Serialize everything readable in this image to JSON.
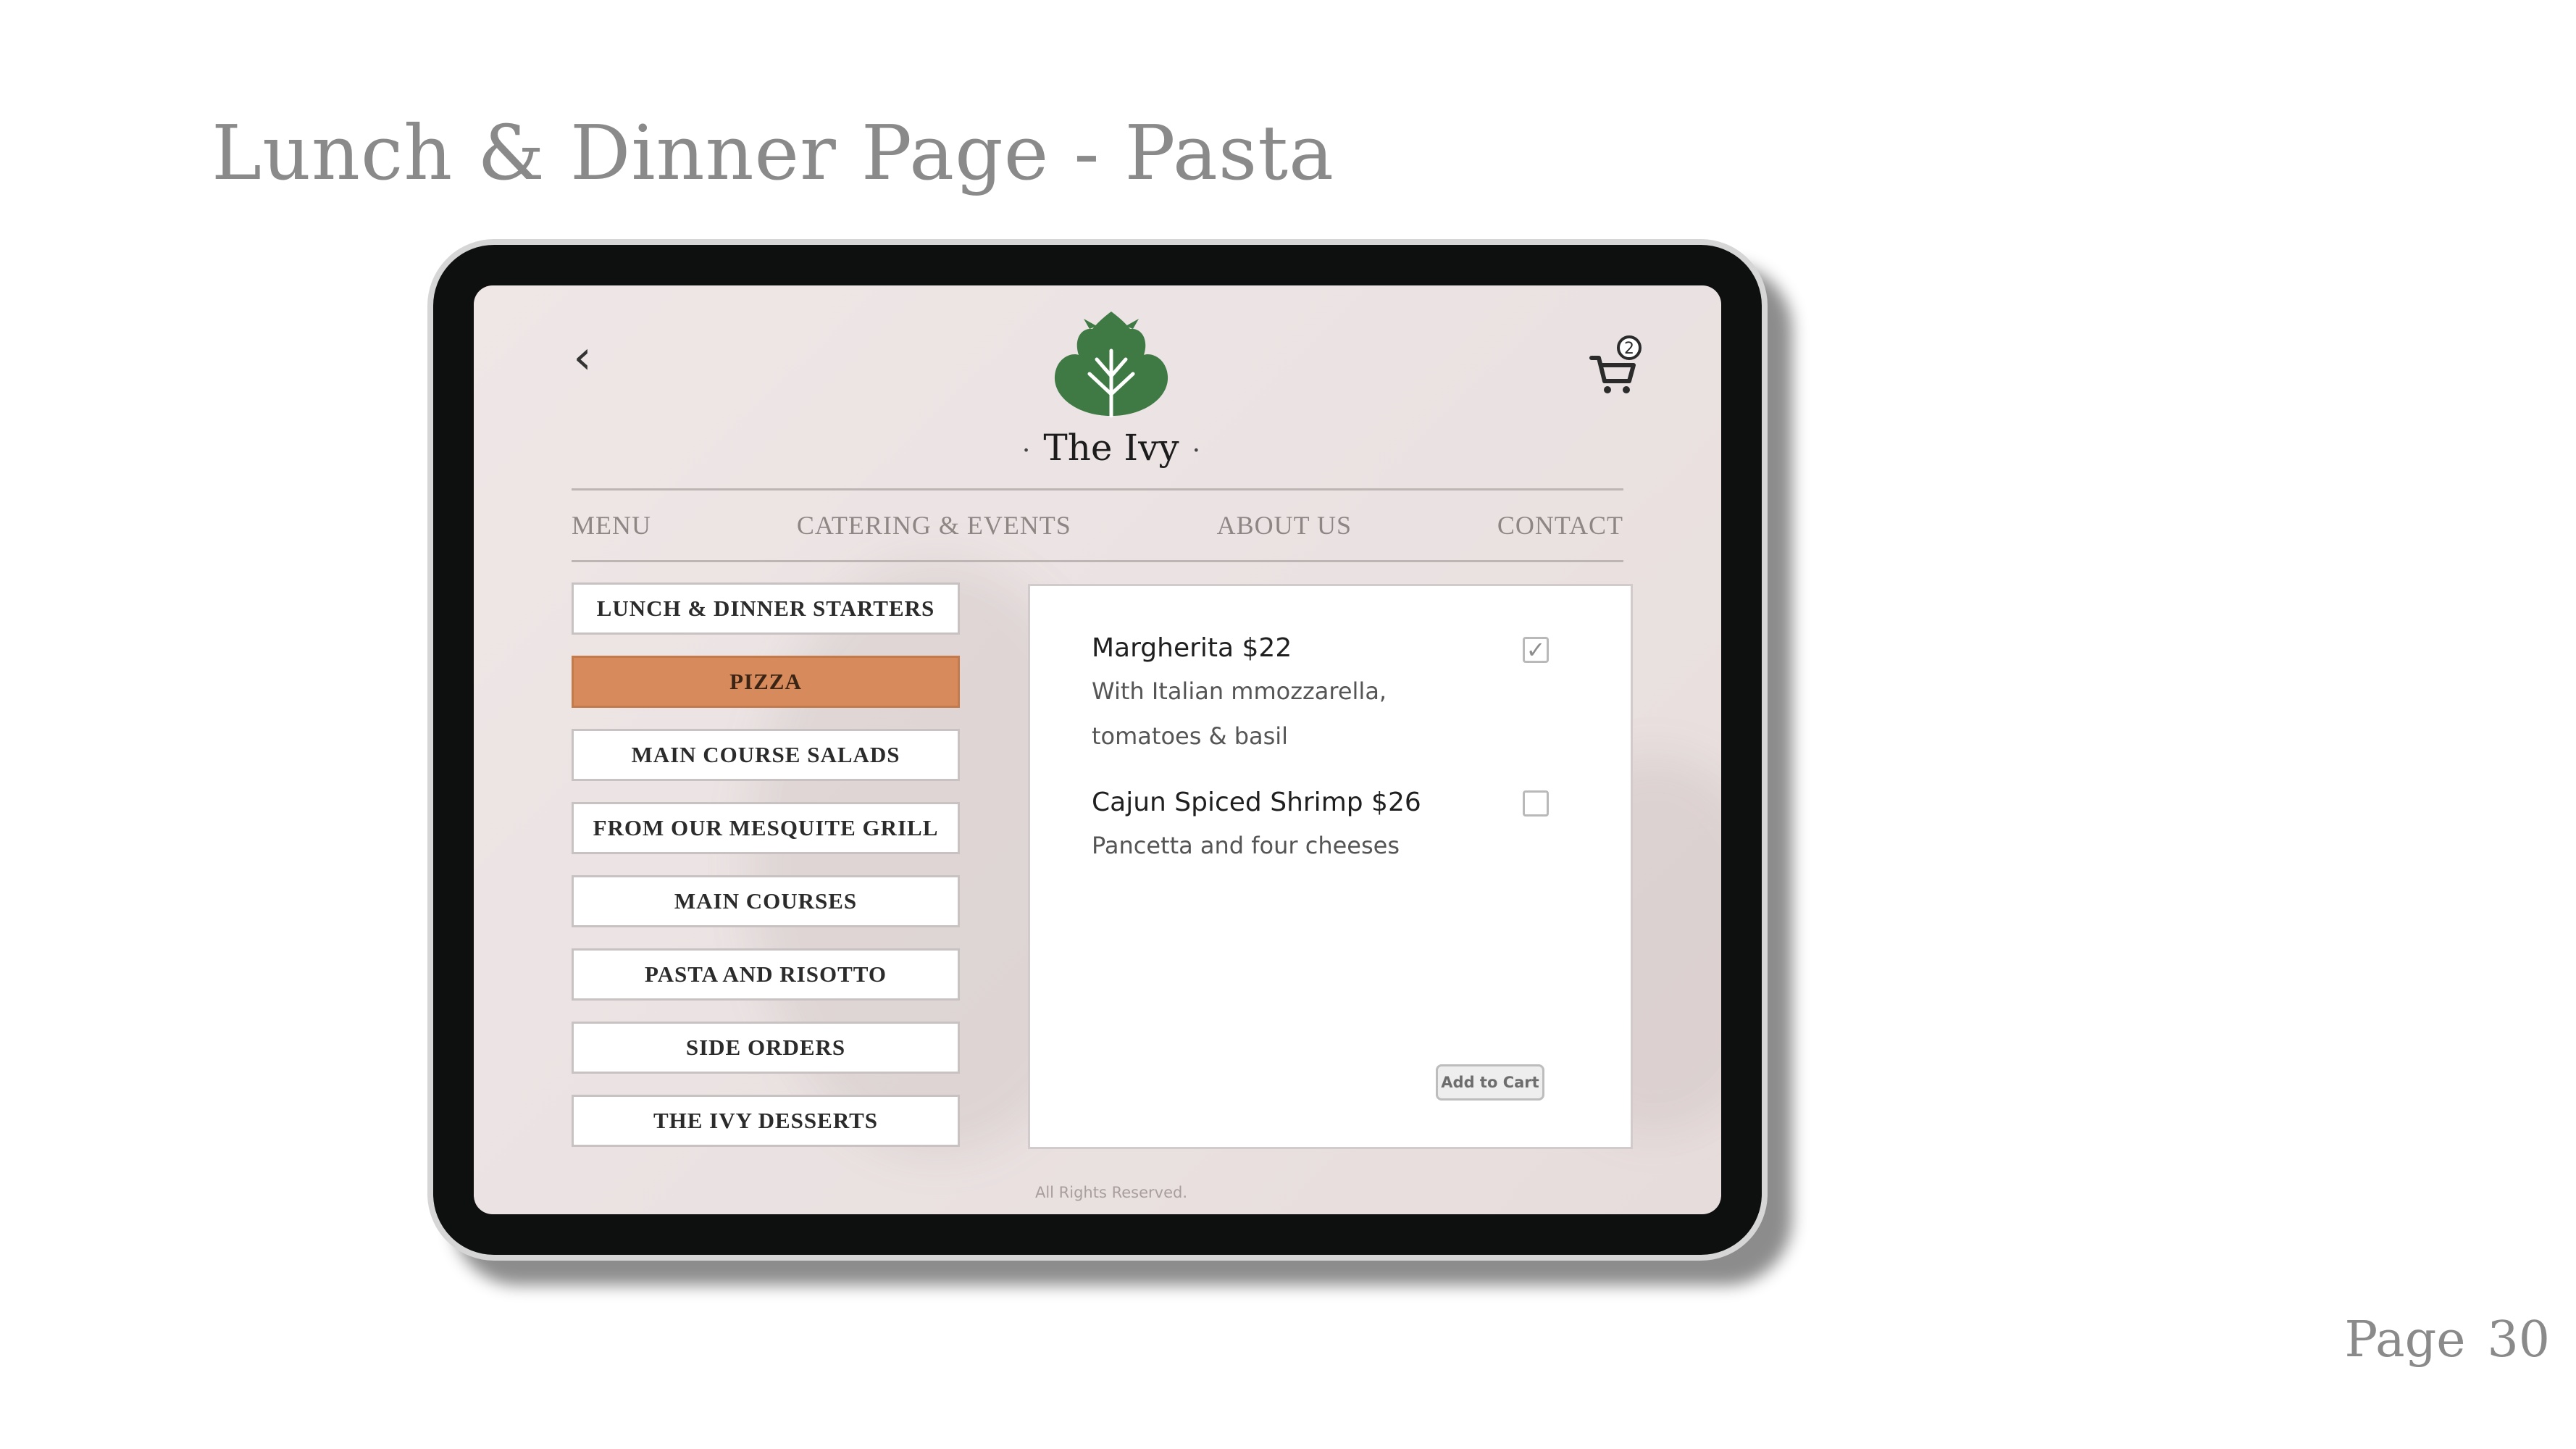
{
  "slide": {
    "title": "Lunch & Dinner Page - Pasta",
    "page_label": "Page",
    "page_number": "30"
  },
  "app": {
    "brand": "The Ivy",
    "cart_count": "2",
    "nav": [
      "MENU",
      "CATERING & EVENTS",
      "ABOUT US",
      "CONTACT"
    ],
    "categories": [
      {
        "label": "LUNCH & DINNER STARTERS",
        "active": false
      },
      {
        "label": "PIZZA",
        "active": true
      },
      {
        "label": "MAIN COURSE SALADS",
        "active": false
      },
      {
        "label": "FROM OUR MESQUITE GRILL",
        "active": false
      },
      {
        "label": "MAIN COURSES",
        "active": false
      },
      {
        "label": "PASTA AND RISOTTO",
        "active": false
      },
      {
        "label": "SIDE ORDERS",
        "active": false
      },
      {
        "label": "THE IVY DESSERTS",
        "active": false
      }
    ],
    "dishes": [
      {
        "name": "Margherita $22",
        "desc_lines": [
          "With Italian mmozzarella,",
          "tomatoes & basil"
        ],
        "checked": true
      },
      {
        "name": "Cajun Spiced Shrimp $26",
        "desc_lines": [
          "Pancetta and four cheeses"
        ],
        "checked": false
      }
    ],
    "add_to_cart": "Add to Cart",
    "footer": "All Rights Reserved."
  },
  "colors": {
    "accent": "#d78b5c",
    "logo_green": "#3f7a44",
    "text_gray": "#8a8a8a"
  },
  "icons": {
    "back": "chevron-left-icon",
    "cart": "shopping-cart-icon",
    "logo": "leaf-logo-icon",
    "check": "check-icon"
  }
}
